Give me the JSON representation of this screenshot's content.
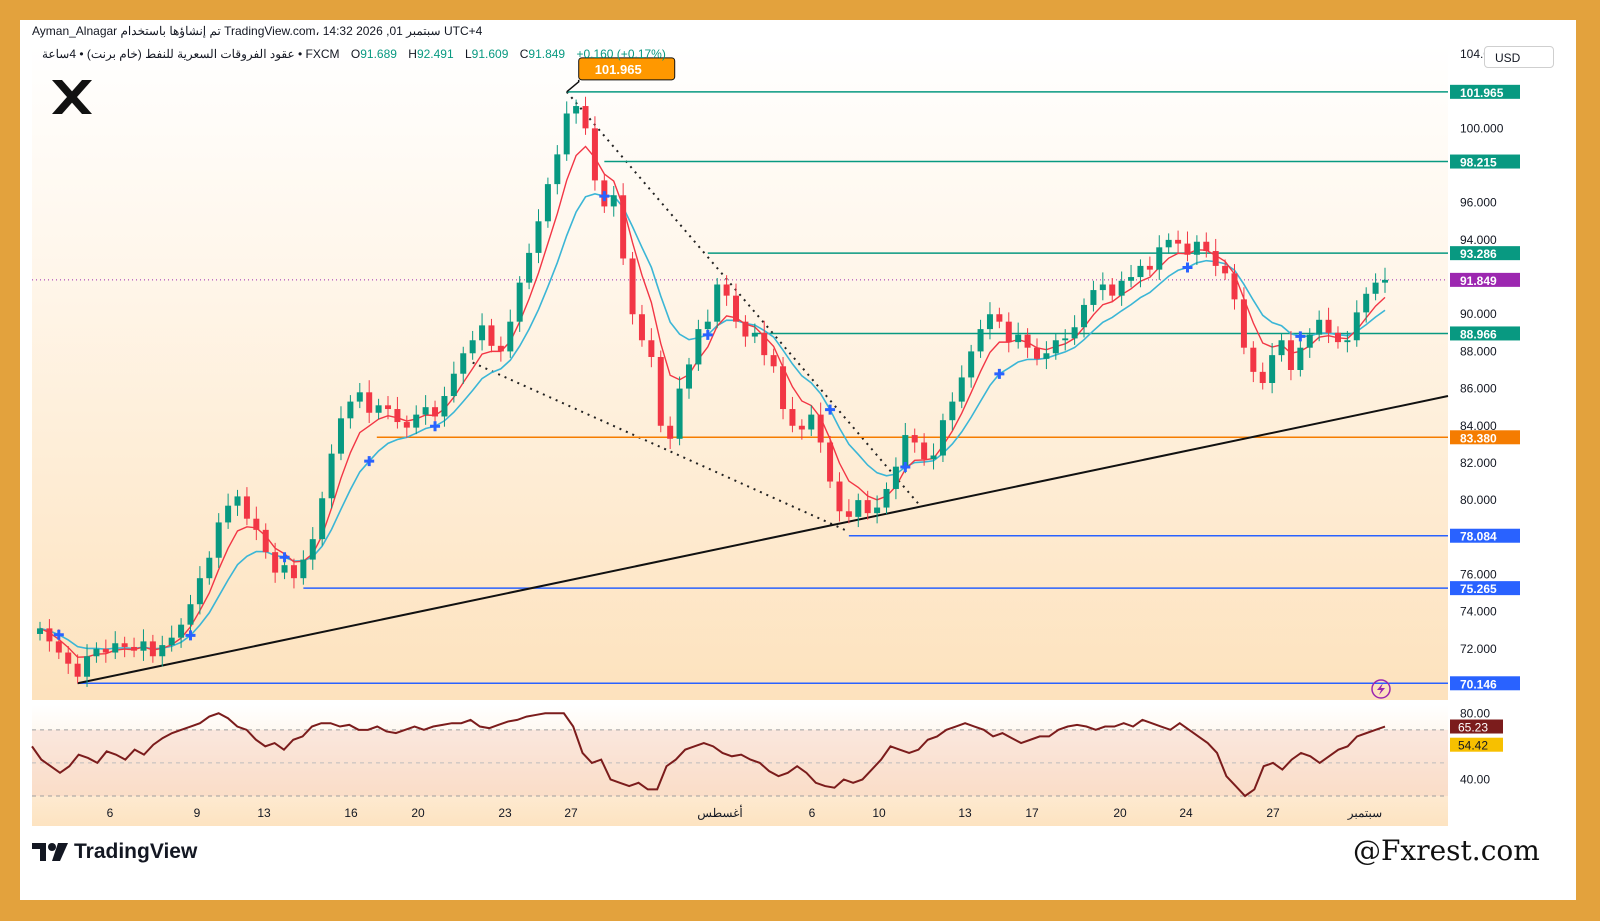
{
  "header": {
    "line1": "Ayman_Alnagar تم إنشاؤها باستخدام TradingView.com، 14:32 2026 ,01 سبتمبر UTC+4",
    "symbol": "عقود الفروقات السعرية للنفط (خام برنت) • 4ساعة • FXCM",
    "open_label": "O",
    "open": "91.689",
    "high_label": "H",
    "high": "92.491",
    "low_label": "L",
    "low": "91.609",
    "close_label": "C",
    "close": "91.849",
    "change": "+0.160 (+0.17%)"
  },
  "currency": "USD",
  "brand": "TradingView",
  "watermark": "@Fxrest.com",
  "colors": {
    "up": "#089981",
    "down": "#f23645",
    "ema_fast": "#f23645",
    "ema_slow": "#3bb6d6",
    "resistance": "#089981",
    "support": "#2962ff",
    "pivot": "#f57c00",
    "rsi": "#7b1c1c",
    "frame": "#e3a23d"
  },
  "chart_data": [
    {
      "type": "line",
      "subtype": "candlestick",
      "ylim": [
        70,
        104
      ],
      "y_ticks": [
        "104.000",
        "100.000",
        "96.000",
        "94.000",
        "90.000",
        "88.000",
        "86.000",
        "84.000",
        "82.000",
        "80.000",
        "76.000",
        "74.000",
        "72.000"
      ],
      "x_ticks": [
        "6",
        "9",
        "13",
        "16",
        "20",
        "23",
        "27",
        "أغسطس",
        "6",
        "10",
        "13",
        "17",
        "20",
        "24",
        "27",
        "سبتمبر"
      ],
      "series": [
        {
          "values": [
            73.1,
            72.4,
            71.8,
            71.2,
            70.5,
            71.6,
            72.0,
            71.8,
            72.3,
            72.1,
            71.9,
            72.4,
            71.6,
            72.2,
            72.6,
            73.3,
            74.4,
            75.8,
            76.9,
            78.8,
            79.7,
            80.2,
            79.0,
            78.4,
            77.2,
            76.1,
            76.5,
            75.8,
            76.8,
            77.9,
            80.1,
            82.5,
            84.4,
            85.3,
            85.8,
            84.7,
            85.1,
            84.9,
            84.2,
            83.9,
            84.6,
            85.0,
            84.5,
            85.6,
            86.8,
            87.9,
            88.6,
            89.4,
            88.3,
            88.0,
            89.6,
            91.7,
            93.3,
            95.0,
            97.0,
            98.6,
            100.8,
            101.2,
            100.0,
            97.2,
            95.8,
            96.4,
            93.0,
            90.0,
            88.6,
            87.7,
            84.0,
            83.3,
            86.0,
            87.3,
            89.2,
            89.6,
            91.6,
            91.0,
            89.6,
            88.8,
            89.0,
            87.8,
            87.2,
            84.9,
            84.0,
            83.8,
            84.6,
            83.1,
            81.0,
            79.4,
            79.1,
            80.0,
            79.3,
            79.6,
            80.6,
            81.8,
            83.5,
            83.1,
            82.2,
            82.4,
            84.3,
            85.3,
            86.6,
            88.0,
            89.2,
            90.0,
            89.6,
            88.5,
            88.9,
            88.2,
            87.6,
            87.9,
            88.6,
            88.7,
            89.3,
            90.5,
            91.3,
            91.6,
            91.0,
            91.8,
            92.0,
            92.6,
            92.4,
            93.6,
            94.0,
            93.8,
            93.2,
            93.9,
            93.4,
            92.6,
            92.2,
            90.8,
            88.2,
            86.9,
            86.3,
            87.8,
            88.6,
            87.0,
            88.2,
            88.9,
            89.7,
            89.0,
            88.5,
            88.6,
            90.1,
            91.1,
            91.7,
            91.849
          ]
        },
        {
          "name": "RSI",
          "values": [
            60,
            52,
            48,
            44,
            48,
            55,
            53,
            50,
            57,
            55,
            52,
            58,
            55,
            61,
            65,
            68,
            70,
            72,
            74,
            78,
            80,
            77,
            72,
            70,
            64,
            60,
            62,
            58,
            64,
            66,
            72,
            74,
            74,
            72,
            73,
            70,
            70,
            72,
            69,
            68,
            70,
            72,
            70,
            72,
            73,
            74,
            74,
            76,
            72,
            71,
            73,
            75,
            76,
            78,
            79,
            80,
            80,
            80,
            72,
            56,
            50,
            52,
            40,
            38,
            36,
            38,
            34,
            34,
            48,
            52,
            58,
            60,
            62,
            60,
            56,
            54,
            55,
            52,
            50,
            45,
            42,
            44,
            48,
            44,
            38,
            36,
            35,
            40,
            38,
            40,
            46,
            52,
            60,
            58,
            56,
            58,
            64,
            66,
            70,
            72,
            74,
            72,
            70,
            66,
            68,
            65,
            62,
            64,
            66,
            66,
            70,
            72,
            73,
            72,
            70,
            72,
            72,
            74,
            72,
            76,
            74,
            72,
            70,
            74,
            70,
            66,
            62,
            56,
            42,
            36,
            30,
            34,
            48,
            50,
            46,
            52,
            56,
            54,
            50,
            54,
            58,
            60,
            66,
            68,
            70,
            72
          ]
        }
      ],
      "overlays": {
        "ema_fast": "red moving average",
        "ema_slow": "light-blue moving average"
      },
      "levels": [
        {
          "value": 101.965,
          "label": "101.965",
          "kind": "resistance"
        },
        {
          "value": 98.215,
          "label": "98.215",
          "kind": "resistance"
        },
        {
          "value": 93.286,
          "label": "93.286",
          "kind": "resistance"
        },
        {
          "value": 91.849,
          "label": "91.849",
          "kind": "last-price"
        },
        {
          "value": 88.966,
          "label": "88.966",
          "kind": "resistance"
        },
        {
          "value": 83.38,
          "label": "83.380",
          "kind": "pivot"
        },
        {
          "value": 78.084,
          "label": "78.084",
          "kind": "support"
        },
        {
          "value": 75.265,
          "label": "75.265",
          "kind": "support"
        },
        {
          "value": 70.146,
          "label": "70.146",
          "kind": "support"
        }
      ],
      "peak_callout": "101.965",
      "trendline": {
        "from": [
          70.146
        ],
        "to": [
          85.6
        ]
      },
      "rsi": {
        "ylim": [
          30,
          85
        ],
        "y_ticks": [
          "80.00",
          "40.00"
        ],
        "value_a": "65.23",
        "value_b": "54.42"
      }
    }
  ]
}
